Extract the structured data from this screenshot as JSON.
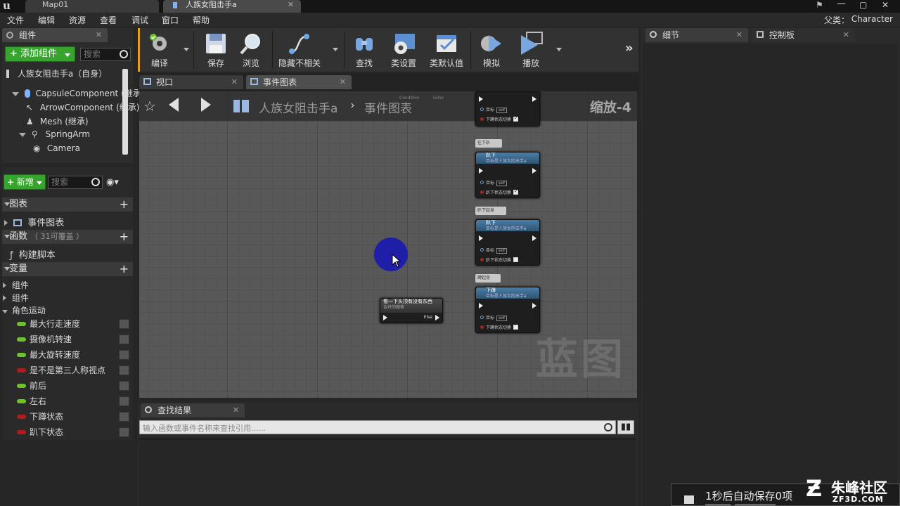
{
  "window": {
    "tabs": [
      {
        "label": "Map01"
      },
      {
        "label": "人族女阻击手a"
      }
    ]
  },
  "menu": [
    "文件",
    "编辑",
    "资源",
    "查看",
    "调试",
    "窗口",
    "帮助"
  ],
  "parent_class": {
    "label": "父类：",
    "value": "Character"
  },
  "components_panel": {
    "tab": "组件",
    "add_button": "添加组件",
    "search_placeholder": "搜索",
    "root": "人族女阻击手a（自身）",
    "tree": [
      {
        "label": "CapsuleComponent (继承)"
      },
      {
        "label": "ArrowComponent (继承)"
      },
      {
        "label": "Mesh (继承)"
      },
      {
        "label": "SpringArm"
      },
      {
        "label": "Camera"
      }
    ]
  },
  "my_blueprint": {
    "new_button": "新增",
    "search_placeholder": "搜索",
    "sections": {
      "graphs": "图表",
      "event_graph": "事件图表",
      "functions": "函数",
      "functions_hint": "（ 31可覆盖 ）",
      "construction": "构建脚本",
      "variables": "变量"
    },
    "categories": [
      "组件",
      "组件",
      "角色运动"
    ],
    "variables": [
      {
        "name": "最大行走速度",
        "color": "#6fc22f"
      },
      {
        "name": "摄像机转速",
        "color": "#6fc22f"
      },
      {
        "name": "最大旋转速度",
        "color": "#6fc22f"
      },
      {
        "name": "是不是第三人称视点",
        "color": "#b01b1b"
      },
      {
        "name": "前后",
        "color": "#6fc22f"
      },
      {
        "name": "左右",
        "color": "#6fc22f"
      },
      {
        "name": "下蹲状态",
        "color": "#b01b1b"
      },
      {
        "name": "趴下状态",
        "color": "#b01b1b"
      }
    ]
  },
  "toolbar": {
    "accent": "#e2a21c",
    "buttons": [
      {
        "label": "编译",
        "icon": "compile-icon"
      },
      {
        "label": "保存",
        "icon": "save-icon"
      },
      {
        "label": "浏览",
        "icon": "browse-icon"
      },
      {
        "label": "隐藏不相关",
        "icon": "hide-unrelated-icon"
      },
      {
        "label": "查找",
        "icon": "find-icon"
      },
      {
        "label": "类设置",
        "icon": "class-settings-icon"
      },
      {
        "label": "类默认值",
        "icon": "class-defaults-icon"
      },
      {
        "label": "模拟",
        "icon": "simulate-icon"
      },
      {
        "label": "播放",
        "icon": "play-icon"
      }
    ]
  },
  "graph": {
    "tabs": [
      "视口",
      "事件图表"
    ],
    "breadcrumb": {
      "blueprint": "人族女阻击手a",
      "graph": "事件图表"
    },
    "zoom": "缩放-4",
    "watermark": "蓝图",
    "nodes": {
      "top": {
        "sub_label": "下蹲状态切换",
        "target": "目标",
        "self": "self"
      },
      "n1": {
        "comment": "往下趴",
        "title": "趴下",
        "subtitle": "目标是人族女阻击手a",
        "target": "目标",
        "self": "self",
        "param": "趴下状态切换",
        "checked": true
      },
      "n2": {
        "comment": "趴下起身",
        "title": "趴下",
        "subtitle": "目标是人族女阻击手a",
        "target": "目标",
        "self": "self",
        "param": "趴下状态切换",
        "checked": false
      },
      "n3": {
        "comment": "蹲起身",
        "title": "下蹲",
        "subtitle": "目标是人族女阻击手a",
        "target": "目标",
        "self": "self",
        "param": "下蹲状态切换",
        "checked": false
      },
      "branch": {
        "title": "看一下头顶有没有东西",
        "subtitle": "合并的图表",
        "else": "Else"
      },
      "faded": {
        "condition": "Condition",
        "false": "False"
      }
    }
  },
  "find_results": {
    "tab": "查找结果",
    "placeholder": "输入函数或事件名称来查找引用......"
  },
  "details": {
    "tab": "细节",
    "control_tab": "控制板"
  },
  "toast": {
    "message": "1秒后自动保存0项"
  },
  "brand": {
    "name": "朱峰社区",
    "url": "ZF3D.COM"
  }
}
